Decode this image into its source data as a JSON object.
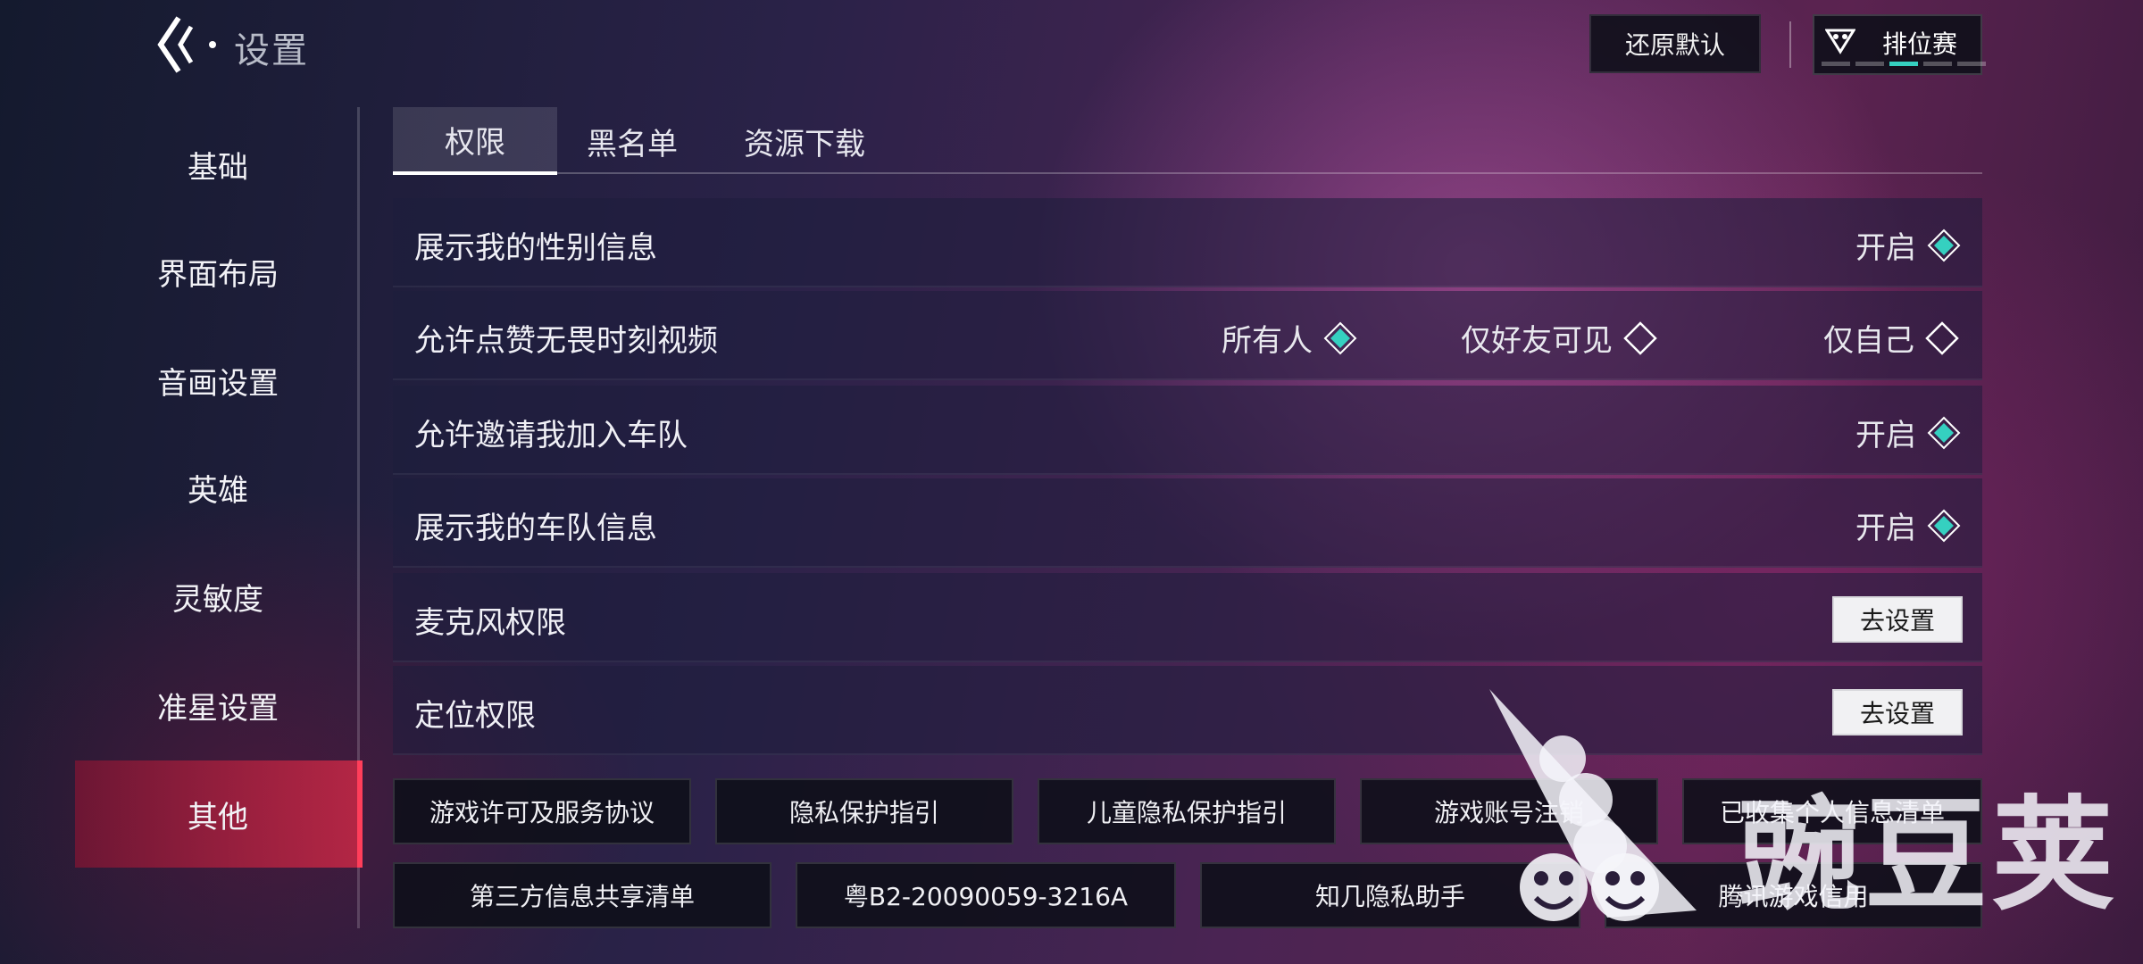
{
  "header": {
    "title": "设置",
    "restore_label": "还原默认",
    "ranked_label": "排位赛"
  },
  "sidebar": {
    "items": [
      {
        "label": "基础"
      },
      {
        "label": "界面布局"
      },
      {
        "label": "音画设置"
      },
      {
        "label": "英雄"
      },
      {
        "label": "灵敏度"
      },
      {
        "label": "准星设置"
      },
      {
        "label": "其他"
      }
    ],
    "active_index": 6
  },
  "tabs": [
    {
      "label": "权限",
      "active": true
    },
    {
      "label": "黑名单",
      "active": false
    },
    {
      "label": "资源下载",
      "active": false
    }
  ],
  "settings": {
    "show_gender": {
      "label": "展示我的性别信息",
      "value": "开启"
    },
    "like_video": {
      "label": "允许点赞无畏时刻视频",
      "options": [
        "所有人",
        "仅好友可见",
        "仅自己"
      ],
      "selected": "所有人"
    },
    "team_invite": {
      "label": "允许邀请我加入车队",
      "value": "开启"
    },
    "show_team": {
      "label": "展示我的车队信息",
      "value": "开启"
    },
    "microphone": {
      "label": "麦克风权限",
      "button": "去设置"
    },
    "location": {
      "label": "定位权限",
      "button": "去设置"
    }
  },
  "links": {
    "row1": [
      "游戏许可及服务协议",
      "隐私保护指引",
      "儿童隐私保护指引",
      "游戏账号注销",
      "已收集个人信息清单"
    ],
    "row2": [
      "第三方信息共享清单",
      "粤B2-20090059-3216A",
      "知几隐私助手",
      "腾讯游戏信用"
    ]
  },
  "watermark": {
    "text": "豌豆荚"
  },
  "colors": {
    "accent_teal": "#35d0c0",
    "active_red": "#ff3e5a",
    "panel_dark": "#0e101a"
  }
}
